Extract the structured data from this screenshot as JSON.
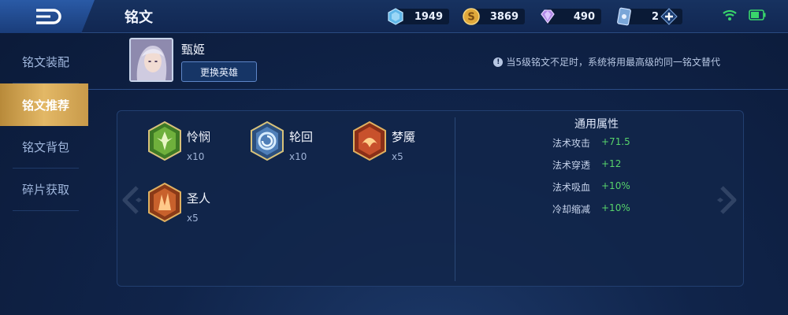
{
  "header": {
    "title": "铭文",
    "back_icon": "back-arrow-icon",
    "currencies": [
      {
        "name": "diamond",
        "icon": "diamond-icon",
        "value": "1949"
      },
      {
        "name": "gold",
        "icon": "gold-coin-icon",
        "value": "3869"
      },
      {
        "name": "gem",
        "icon": "purple-gem-icon",
        "value": "490"
      },
      {
        "name": "ticket",
        "icon": "card-ticket-icon",
        "value": "2"
      }
    ]
  },
  "sidebar": {
    "items": [
      {
        "label": "铭文装配",
        "active": false
      },
      {
        "label": "铭文推荐",
        "active": true
      },
      {
        "label": "铭文背包",
        "active": false
      },
      {
        "label": "碎片获取",
        "active": false
      }
    ]
  },
  "hero": {
    "name": "甄姬",
    "change_button": "更换英雄",
    "notice": "当5级铭文不足时，系统将用最高级的同一铭文替代"
  },
  "runes": [
    {
      "name": "怜悯",
      "count": "x10",
      "color": "#6fb03c"
    },
    {
      "name": "轮回",
      "count": "x10",
      "color": "#4f7fb8"
    },
    {
      "name": "梦魇",
      "count": "x5",
      "color": "#c8512c"
    },
    {
      "name": "圣人",
      "count": "x5",
      "color": "#c8612c"
    }
  ],
  "attributes": {
    "title": "通用属性",
    "rows": [
      {
        "label": "法术攻击",
        "value": "+71.5"
      },
      {
        "label": "法术穿透",
        "value": "+12"
      },
      {
        "label": "法术吸血",
        "value": "+10%"
      },
      {
        "label": "冷却缩减",
        "value": "+10%"
      }
    ]
  },
  "colors": {
    "accent_gold": "#e3b866",
    "positive_green": "#57d36b"
  }
}
